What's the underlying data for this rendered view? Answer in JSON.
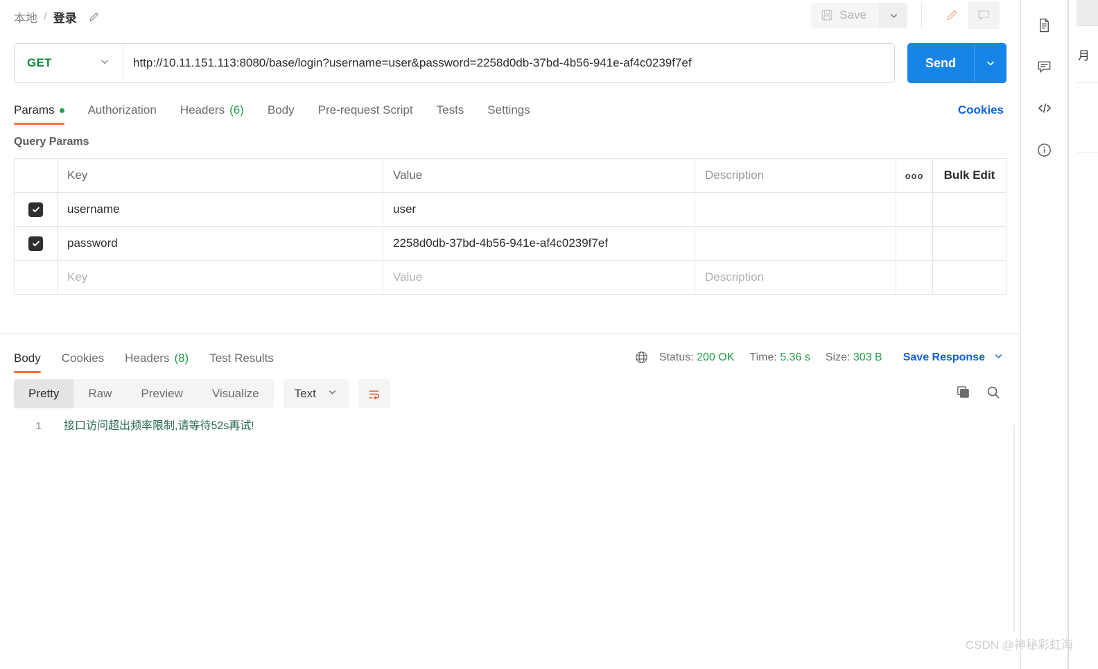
{
  "topbar": {
    "breadcrumb_parent": "本地",
    "breadcrumb_sep": "/",
    "breadcrumb_current": "登录",
    "save_label": "Save"
  },
  "request": {
    "method": "GET",
    "url": "http://10.11.151.113:8080/base/login?username=user&password=2258d0db-37bd-4b56-941e-af4c0239f7ef",
    "send_label": "Send"
  },
  "request_tabs": [
    {
      "label": "Params",
      "active": true,
      "dot": true
    },
    {
      "label": "Authorization",
      "active": false
    },
    {
      "label": "Headers",
      "count": "(6)",
      "active": false
    },
    {
      "label": "Body",
      "active": false
    },
    {
      "label": "Pre-request Script",
      "active": false
    },
    {
      "label": "Tests",
      "active": false
    },
    {
      "label": "Settings",
      "active": false
    }
  ],
  "cookies_link": "Cookies",
  "query_params": {
    "title": "Query Params",
    "columns": {
      "key": "Key",
      "value": "Value",
      "description": "Description",
      "bulk_edit": "Bulk Edit",
      "more": "ooo"
    },
    "rows": [
      {
        "checked": true,
        "key": "username",
        "value": "user",
        "description": ""
      },
      {
        "checked": true,
        "key": "password",
        "value": "2258d0db-37bd-4b56-941e-af4c0239f7ef",
        "description": ""
      }
    ],
    "empty_row": {
      "key_placeholder": "Key",
      "value_placeholder": "Value",
      "description_placeholder": "Description"
    }
  },
  "response_tabs": [
    {
      "label": "Body",
      "active": true
    },
    {
      "label": "Cookies",
      "active": false
    },
    {
      "label": "Headers",
      "count": "(8)",
      "active": false
    },
    {
      "label": "Test Results",
      "active": false
    }
  ],
  "response_meta": {
    "status_label": "Status:",
    "status_value": "200 OK",
    "time_label": "Time:",
    "time_value": "5.36 s",
    "size_label": "Size:",
    "size_value": "303 B",
    "save_response": "Save Response"
  },
  "body_toolbar": {
    "views": [
      {
        "label": "Pretty",
        "active": true
      },
      {
        "label": "Raw",
        "active": false
      },
      {
        "label": "Preview",
        "active": false
      },
      {
        "label": "Visualize",
        "active": false
      }
    ],
    "format": "Text"
  },
  "response_body": {
    "line_number": "1",
    "text": "接口访问超出频率限制,请等待52s再试!"
  },
  "far_right_panel": {
    "partial_text": "月"
  },
  "watermark": "CSDN @神秘彩虹海",
  "colors": {
    "accent_orange": "#ff6c37",
    "send_blue": "#1784e8",
    "link_blue": "#1262d8",
    "green": "#1e9e4a",
    "method_green": "#0f8a3c"
  }
}
